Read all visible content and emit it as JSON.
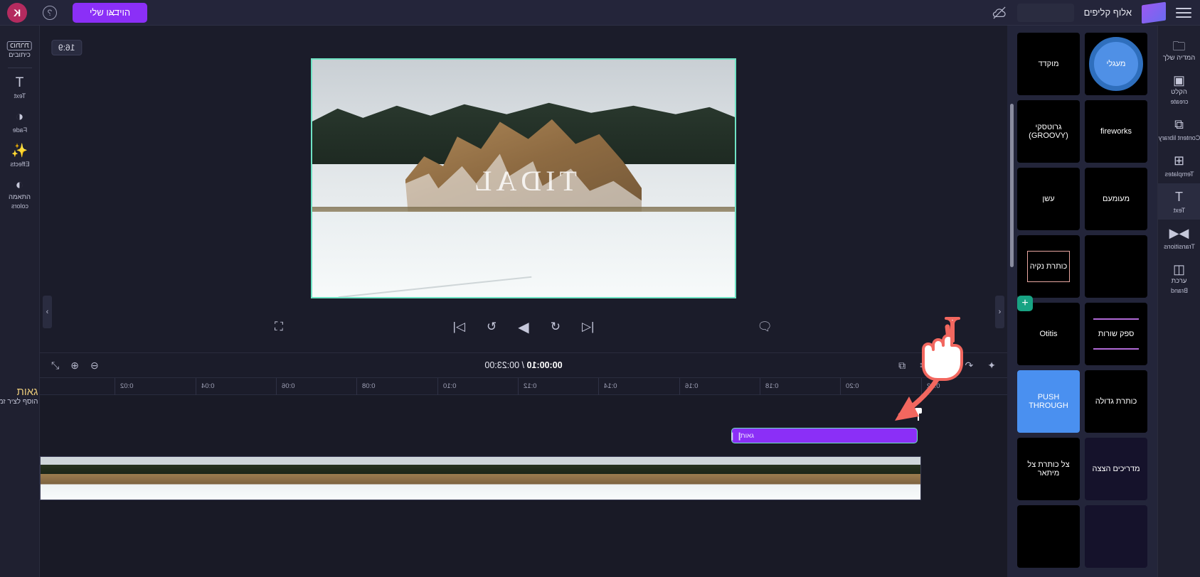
{
  "topbar": {
    "logo": "K",
    "help_icon": "help-icon",
    "project_name": "הוידאו שלי",
    "cloud_icon": "cloud-offline-icon",
    "account_name": "אלוף קליפים",
    "menu_icon": "hamburger-icon"
  },
  "left_rail": {
    "captions_badge": "כותרת",
    "captions_label": "כיתובים",
    "items": [
      {
        "icon": "T",
        "label": "Text",
        "name": "text"
      },
      {
        "icon": "◑",
        "label": "Fade",
        "name": "fade"
      },
      {
        "icon": "✨",
        "label": "Effects",
        "name": "effects"
      },
      {
        "icon": "◐",
        "label_he": "התאמה",
        "label": "colors",
        "name": "colors"
      }
    ],
    "footer_title": "גאות",
    "footer_sub": "הוסף לציר זמן"
  },
  "stage": {
    "ratio_chip": "16:9",
    "video_overlay_text": "TIDAL",
    "player": {
      "fullscreen_icon": "fullscreen-icon",
      "skip_start_icon": "skip-to-start-icon",
      "back2_icon": "back-2-seconds-icon",
      "play_icon": "play-icon",
      "fwd2_icon": "forward-2-seconds-icon",
      "skip_end_icon": "skip-to-end-icon",
      "captions_icon": "captions-toggle-icon"
    },
    "left_arrow": "‹",
    "right_arrow": "›",
    "collapse_icon": "⌄"
  },
  "timeline": {
    "tools_left": [
      "split-arrows-icon",
      "zoom-in-icon",
      "zoom-out-icon"
    ],
    "current_time": "00:00:10",
    "separator": "/",
    "total_time": "00:23:00",
    "tools_right": [
      "split-icon",
      "scissors-icon",
      "undo-icon",
      "redo-icon",
      "magic-icon"
    ],
    "ruler_ticks": [
      "0:22",
      "0:20",
      "0:18",
      "0:16",
      "0:14",
      "0:12",
      "0:10",
      "0:08",
      "0:06",
      "0:04",
      "0:02"
    ],
    "clip": {
      "label": "גאות",
      "grip": "❙❙"
    }
  },
  "templates_panel": {
    "add_button": "+",
    "edge_arrow": "›",
    "tiles": [
      {
        "text": "מוקדד",
        "style": "plain"
      },
      {
        "text": "מעגלי",
        "style": "circle-blue"
      },
      {
        "text": "גרוטסקי (GROOVY)",
        "style": "plain"
      },
      {
        "text": "fireworks",
        "style": "plain"
      },
      {
        "text": "עשן",
        "style": "plain"
      },
      {
        "text": "מעומעם",
        "style": "plain"
      },
      {
        "text": "כותרת נקיה",
        "style": "outline-box"
      },
      {
        "text": "",
        "style": "plain"
      },
      {
        "text": "Otitis",
        "style": "plain"
      },
      {
        "text": "ספק שורות",
        "style": "purple-underline"
      },
      {
        "text": "PUSH THROUGH",
        "style": "blue"
      },
      {
        "text": "כותרת גדולה",
        "style": "plain"
      },
      {
        "text": "צל כותרת צל מיתאר",
        "style": "plain"
      },
      {
        "text": "מדריכים הצצה",
        "style": "navy"
      },
      {
        "text": "",
        "style": "plain"
      },
      {
        "text": "",
        "style": "navy"
      }
    ]
  },
  "right_rail": {
    "items": [
      {
        "icon": "🗀",
        "label_he": "המדיה שלך",
        "name": "your-media"
      },
      {
        "icon": "▣",
        "label_he": "הקלט",
        "label": "create",
        "name": "record-create"
      },
      {
        "icon": "⧉",
        "label": "Content library",
        "name": "content-library"
      },
      {
        "icon": "⊞",
        "label": "Templates",
        "name": "templates"
      },
      {
        "icon": "T",
        "label": "Text",
        "name": "text",
        "active": true
      },
      {
        "icon": "▶◀",
        "label": "Transitions",
        "name": "transitions"
      },
      {
        "icon": "◫",
        "label": "Brand",
        "label_he": "ערכת",
        "name": "brand"
      }
    ]
  },
  "colors": {
    "accent_purple": "#8b2ff7",
    "accent_teal": "#6fe3c4",
    "cursor_red": "#f2675f",
    "add_green": "#18a383"
  }
}
